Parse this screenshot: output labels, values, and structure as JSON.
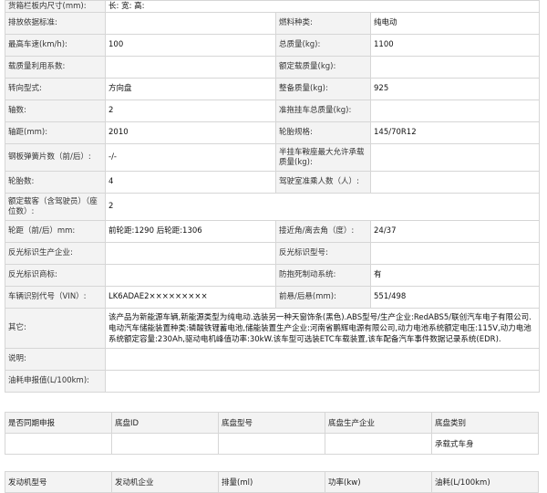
{
  "spec": {
    "r0": {
      "l1": "货箱栏板内尺寸(mm):",
      "v1": "长:  宽:  高:"
    },
    "r1": {
      "l1": "排放依据标准:",
      "v1": "",
      "l2": "燃料种类:",
      "v2": "纯电动"
    },
    "r2": {
      "l1": "最高车速(km/h):",
      "v1": "100",
      "l2": "总质量(kg):",
      "v2": "1100"
    },
    "r3": {
      "l1": "载质量利用系数:",
      "v1": "",
      "l2": "额定载质量(kg):",
      "v2": ""
    },
    "r4": {
      "l1": "转向型式:",
      "v1": "方向盘",
      "l2": "整备质量(kg):",
      "v2": "925"
    },
    "r5": {
      "l1": "轴数:",
      "v1": "2",
      "l2": "准拖挂车总质量(kg):",
      "v2": ""
    },
    "r6": {
      "l1": "轴距(mm):",
      "v1": "2010",
      "l2": "轮胎规格:",
      "v2": "145/70R12"
    },
    "r7": {
      "l1": "钢板弹簧片数（前/后）:",
      "v1": "-/-",
      "l2": "半挂车鞍座最大允许承载质量(kg):",
      "v2": ""
    },
    "r8": {
      "l1": "轮胎数:",
      "v1": "4",
      "l2": "驾驶室准乘人数（人）:",
      "v2": ""
    },
    "r9": {
      "l1": "额定载客（含驾驶员）（座位数）:",
      "v1": "2"
    },
    "r10": {
      "l1": "轮距（前/后）mm:",
      "v1": "前轮距:1290 后轮距:1306",
      "l2": "接近角/离去角（度）:",
      "v2": "24/37"
    },
    "r11": {
      "l1": "反光标识生产企业:",
      "v1": "",
      "l2": "反光标识型号:",
      "v2": ""
    },
    "r12": {
      "l1": "反光标识商标:",
      "v1": "",
      "l2": "防抱死制动系统:",
      "v2": "有"
    },
    "r13": {
      "l1": "车辆识别代号（VIN）:",
      "v1": "LK6ADAE2×××××××××",
      "l2": "前悬/后悬(mm):",
      "v2": "551/498"
    },
    "r14": {
      "l1": "其它:",
      "v1": "该产品为新能源车辆,新能源类型为纯电动.选装另一种天窗饰条(黑色).ABS型号/生产企业:RedABS5/联创汽车电子有限公司.电动汽车储能装置种类:磷酸铁锂蓄电池,储能装置生产企业:河南省鹏辉电源有限公司,动力电池系统额定电压:115V,动力电池系统额定容量:230Ah,驱动电机峰值功率:30kW.该车型可选装ETC车载装置,该车配备汽车事件数据记录系统(EDR)."
    },
    "r15": {
      "l1": "说明:",
      "v1": ""
    },
    "r16": {
      "l1": "油耗申报值(L/100km):",
      "v1": ""
    }
  },
  "chassis": {
    "headers": [
      "是否同期申报",
      "底盘ID",
      "底盘型号",
      "底盘生产企业",
      "底盘类别"
    ],
    "row": [
      "",
      "",
      "",
      "",
      "承载式车身"
    ]
  },
  "engine": {
    "headers": [
      "发动机型号",
      "发动机企业",
      "排量(ml)",
      "功率(kw)",
      "油耗(L/100km)"
    ]
  }
}
